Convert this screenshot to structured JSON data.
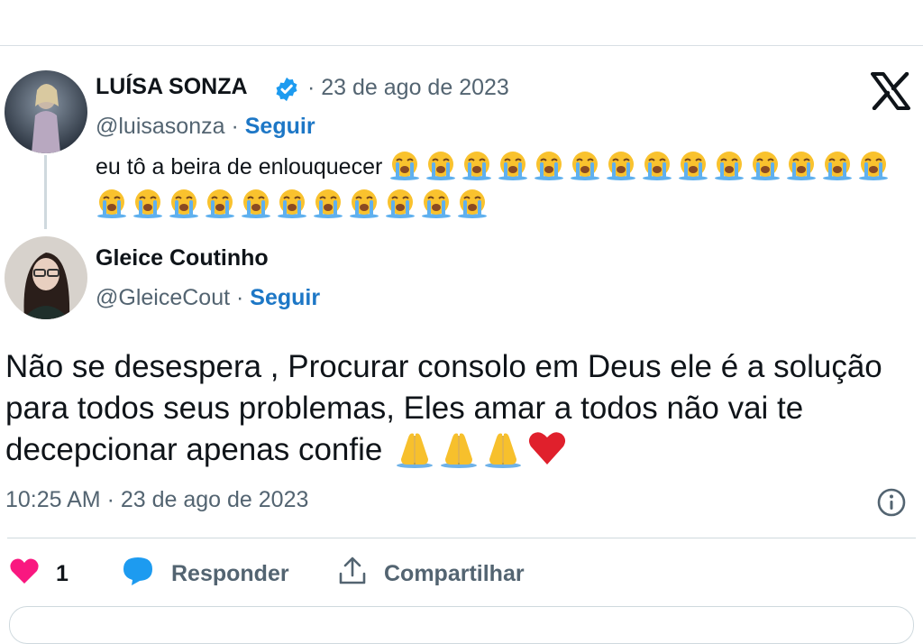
{
  "original_tweet": {
    "author_name": "LUÍSA SONZA",
    "date": "· 23 de ago de 2023",
    "handle": "@luisasonza",
    "separator": "·",
    "follow_label": "Seguir",
    "text": "eu tô a beira de enlouquecer",
    "emoji_count": 25,
    "emoji_name": "loudly-crying-face"
  },
  "reply_tweet": {
    "author_name": "Gleice Coutinho",
    "handle": "@GleiceCout",
    "separator": "·",
    "follow_label": "Seguir",
    "text": "Não se desespera , Procurar consolo em Deus ele é a solução para todos seus problemas, Eles amar a todos não vai te decepcionar apenas confie",
    "trailing_emojis": [
      "folded-hands",
      "folded-hands",
      "folded-hands",
      "red-heart"
    ],
    "timestamp": "10:25 AM · 23 de ago de 2023"
  },
  "actions": {
    "like_count": "1",
    "reply_label": "Responder",
    "share_label": "Compartilhar"
  },
  "colors": {
    "follow": "#1d77c6",
    "muted": "#536471",
    "like": "#f91880",
    "reply_icon": "#1d9bf0",
    "verified": "#1d9bf0"
  },
  "icons": {
    "brand": "x-logo",
    "verified": "verified-badge-icon",
    "info": "info-icon",
    "like": "heart-icon",
    "reply": "speech-bubble-icon",
    "share": "share-icon"
  }
}
